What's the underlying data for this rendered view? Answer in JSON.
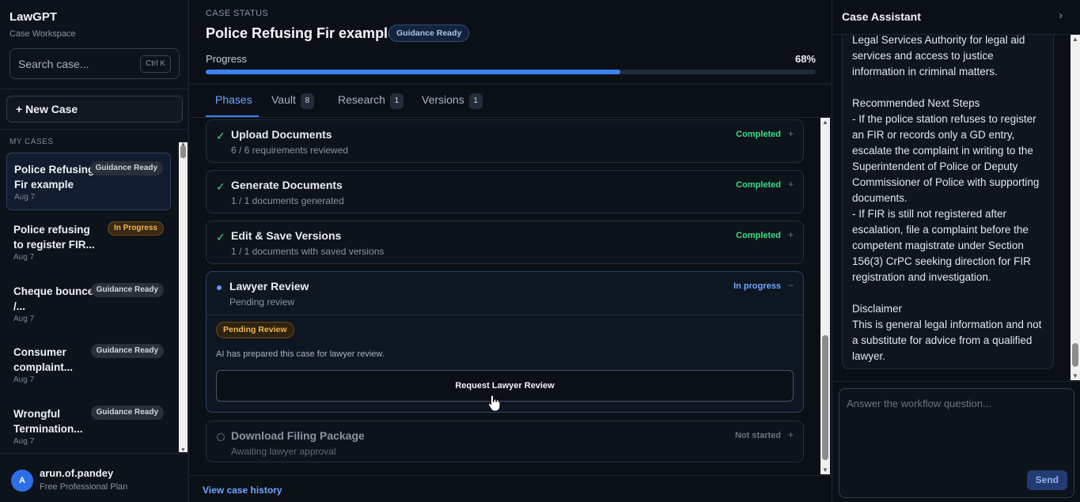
{
  "app": {
    "name": "LawGPT",
    "subtitle": "Case Workspace"
  },
  "search": {
    "placeholder": "Search case...",
    "shortcut": "Ctrl K"
  },
  "new_case_label": "+ New Case",
  "my_cases_label": "MY CASES",
  "cases": [
    {
      "title": "Police Refusing Fir example",
      "badge": "Guidance Ready",
      "date": "Aug 7"
    },
    {
      "title": "Police refusing to register FIR...",
      "badge": "In Progress",
      "date": "Aug 7"
    },
    {
      "title": "Cheque bounce /...",
      "badge": "Guidance Ready",
      "date": "Aug 7"
    },
    {
      "title": "Consumer complaint...",
      "badge": "Guidance Ready",
      "date": "Aug 7"
    },
    {
      "title": "Wrongful Termination...",
      "badge": "Guidance Ready",
      "date": "Aug 7"
    }
  ],
  "user": {
    "initial": "A",
    "name": "arun.of.pandey",
    "plan": "Free Professional Plan"
  },
  "main": {
    "status_label": "CASE STATUS",
    "title": "Police Refusing Fir example",
    "status_badge": "Guidance Ready",
    "progress_label": "Progress",
    "progress_text": "68%",
    "progress_value": 68,
    "tabs": [
      {
        "label": "Phases",
        "count": ""
      },
      {
        "label": "Vault",
        "count": "8"
      },
      {
        "label": "Research",
        "count": "1"
      },
      {
        "label": "Versions",
        "count": "1"
      }
    ],
    "phases": [
      {
        "name": "Upload Documents",
        "desc": "6 / 6 requirements reviewed",
        "status": "Completed",
        "toggle": "+"
      },
      {
        "name": "Generate Documents",
        "desc": "1 / 1 documents generated",
        "status": "Completed",
        "toggle": "+"
      },
      {
        "name": "Edit & Save Versions",
        "desc": "1 / 1 documents with saved versions",
        "status": "Completed",
        "toggle": "+"
      },
      {
        "name": "Lawyer Review",
        "desc": "Pending review",
        "status": "In progress",
        "toggle": "−",
        "pending_badge": "Pending Review",
        "note": "AI has prepared this case for lawyer review.",
        "button": "Request Lawyer Review"
      },
      {
        "name": "Download Filing Package",
        "desc": "Awaiting lawyer approval",
        "status": "Not started",
        "toggle": "+"
      }
    ],
    "history_link": "View case history"
  },
  "assistant": {
    "title": "Case Assistant",
    "message": "Legal Services Authority for legal aid services and access to justice information in criminal matters.\n\nRecommended Next Steps\n- If the police station refuses to register an FIR or records only a GD entry, escalate the complaint in writing to the Superintendent of Police or Deputy Commissioner of Police with supporting documents.\n- If FIR is still not registered after escalation, file a complaint before the competent magistrate under Section 156(3) CrPC seeking direction for FIR registration and investigation.\n\nDisclaimer\nThis is general legal information and not a substitute for advice from a qualified lawyer.",
    "input_placeholder": "Answer the workflow question...",
    "send_label": "Send"
  },
  "colors": {
    "accent": "#3b82f6",
    "completed": "#3ddc84",
    "in_progress_badge": "#f0b552",
    "background": "#0b1017"
  }
}
